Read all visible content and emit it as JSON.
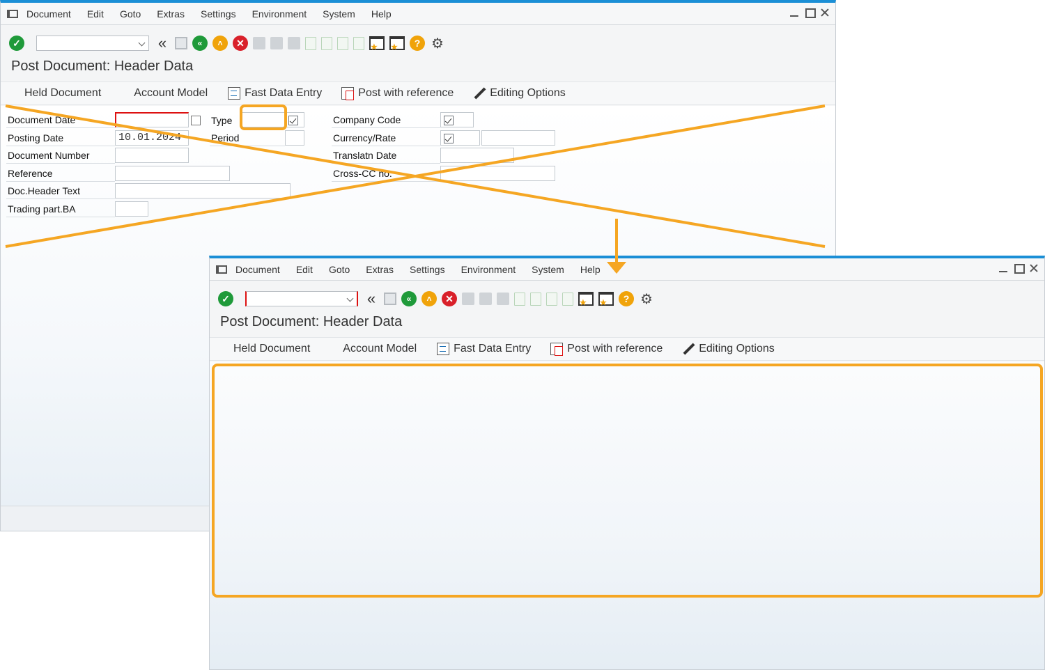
{
  "menu": {
    "items": [
      "Document",
      "Edit",
      "Goto",
      "Extras",
      "Settings",
      "Environment",
      "System",
      "Help"
    ]
  },
  "page_title": "Post Document: Header Data",
  "actions": {
    "held_document": "Held Document",
    "account_model": "Account Model",
    "fast_data_entry": "Fast Data Entry",
    "post_with_reference": "Post with reference",
    "editing_options": "Editing Options"
  },
  "form": {
    "document_date": {
      "label": "Document Date",
      "value": ""
    },
    "posting_date": {
      "label": "Posting Date",
      "value": "10.01.2024"
    },
    "document_number": {
      "label": "Document Number",
      "value": ""
    },
    "reference": {
      "label": "Reference",
      "value": ""
    },
    "doc_header_text": {
      "label": "Doc.Header Text",
      "value": ""
    },
    "trading_part_ba": {
      "label": "Trading part.BA",
      "value": ""
    },
    "type": {
      "label": "Type",
      "value": ""
    },
    "period": {
      "label": "Period",
      "value": ""
    },
    "company_code": {
      "label": "Company Code",
      "value": ""
    },
    "currency_rate": {
      "label": "Currency/Rate",
      "value": ""
    },
    "translatn_date": {
      "label": "Translatn Date",
      "value": ""
    },
    "cross_cc_no": {
      "label": "Cross-CC no.",
      "value": ""
    }
  },
  "colors": {
    "highlight": "#f5a623",
    "sap_blue": "#1b8fd6",
    "ok_green": "#1f9a3a",
    "cancel_red": "#d9202a"
  }
}
